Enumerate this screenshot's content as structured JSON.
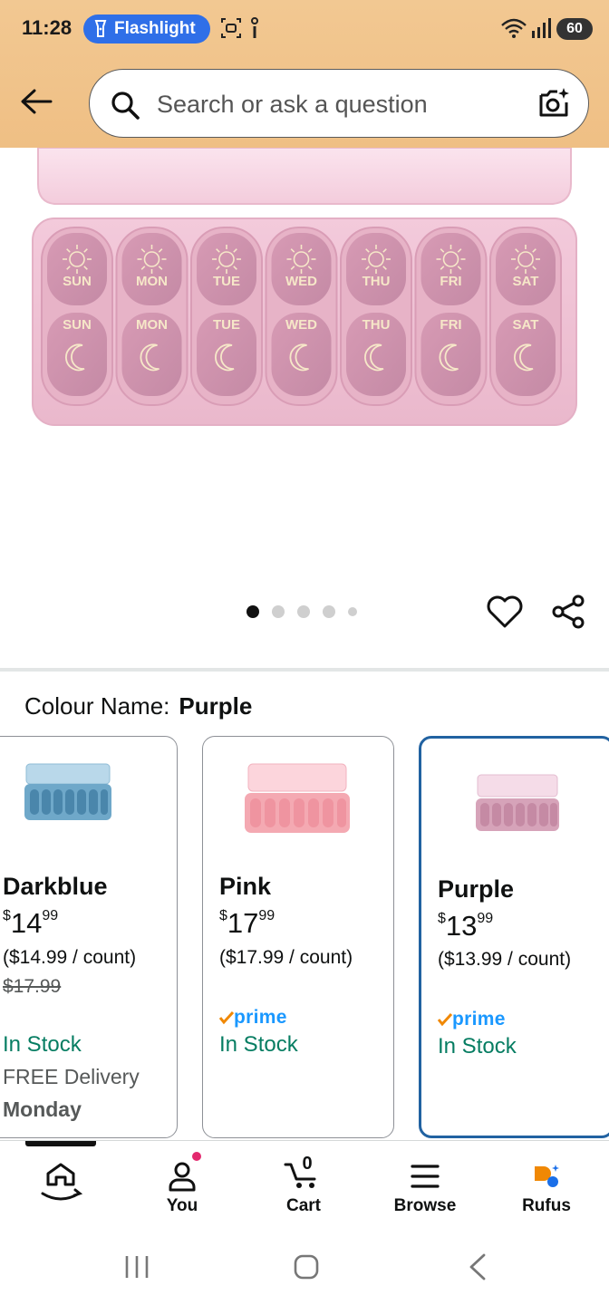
{
  "status_bar": {
    "time": "11:28",
    "flashlight_label": "Flashlight",
    "battery": "60"
  },
  "header": {
    "back_icon": "arrow-left-icon",
    "search": {
      "placeholder": "Search or ask a question",
      "value": ""
    },
    "camera_icon": "camera-search-icon"
  },
  "product": {
    "image_days": [
      "SUN",
      "MON",
      "TUE",
      "WED",
      "THU",
      "FRI",
      "SAT"
    ],
    "carousel": {
      "count": 5,
      "active_index": 0
    }
  },
  "variant": {
    "label": "Colour Name:",
    "selected": "Purple",
    "options": [
      {
        "name": "Darkblue",
        "symbol": "$",
        "whole": "14",
        "fraction": "99",
        "unit_price": "($14.99 / count)",
        "list_price": "$17.99",
        "prime": false,
        "stock": "In Stock",
        "delivery": "FREE Delivery",
        "delivery_day": "Monday",
        "thumb_color": "#6fa8c9"
      },
      {
        "name": "Pink",
        "symbol": "$",
        "whole": "17",
        "fraction": "99",
        "unit_price": "($17.99 / count)",
        "list_price": "",
        "prime": true,
        "prime_label": "prime",
        "stock": "In Stock",
        "delivery": "",
        "delivery_day": "",
        "thumb_color": "#f4a9b2"
      },
      {
        "name": "Purple",
        "symbol": "$",
        "whole": "13",
        "fraction": "99",
        "unit_price": "($13.99 / count)",
        "list_price": "",
        "prime": true,
        "prime_label": "prime",
        "stock": "In Stock",
        "delivery": "",
        "delivery_day": "",
        "thumb_color": "#d6a3b9"
      }
    ]
  },
  "bottom_nav": {
    "items": [
      {
        "label": "",
        "icon": "home-icon"
      },
      {
        "label": "You",
        "icon": "person-icon"
      },
      {
        "label": "Cart",
        "icon": "cart-icon",
        "count": "0"
      },
      {
        "label": "Browse",
        "icon": "menu-icon"
      },
      {
        "label": "Rufus",
        "icon": "rufus-icon"
      }
    ]
  },
  "colors": {
    "header_bg": "#efbf84",
    "in_stock": "#067d62",
    "selected_border": "#2162a1",
    "prime_blue": "#1a98ff",
    "prime_check": "#f08804",
    "flashlight_pill": "#2f6fe8"
  }
}
